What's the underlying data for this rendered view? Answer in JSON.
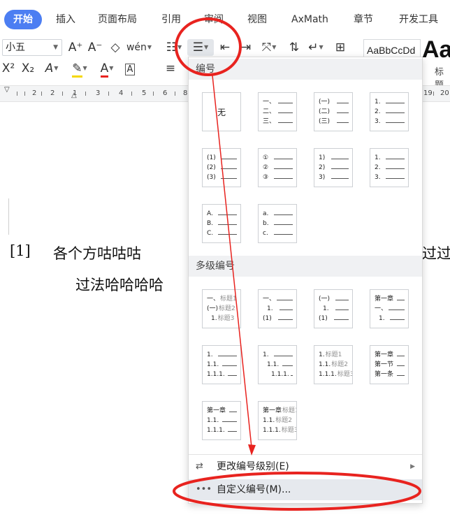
{
  "ribbon": {
    "tabs": [
      {
        "label": "开始",
        "active": true
      },
      {
        "label": "插入"
      },
      {
        "label": "页面布局"
      },
      {
        "label": "引用"
      },
      {
        "label": "审阅"
      },
      {
        "label": "视图"
      },
      {
        "label": "AxMath"
      },
      {
        "label": "章节"
      },
      {
        "label": "开发工具"
      }
    ]
  },
  "toolbar": {
    "font_size_value": "小五",
    "grow_font_label": "A⁺",
    "shrink_font_label": "A⁻",
    "pinyin_label": "wén",
    "superscript_label": "X²",
    "subscript_label": "X₂",
    "styles_preview_text": "AaBbCcDd",
    "styles_big_text": "Aa",
    "styles_caption": "标题"
  },
  "ruler": {
    "numbers": [
      "2",
      "1",
      "2",
      "3",
      "4",
      "5",
      "6",
      "7",
      "8",
      "19",
      "20"
    ]
  },
  "document": {
    "line1_ref": "[1]",
    "line1_text": "各个方咕咕咕",
    "line1_right": "过过",
    "line2_text": "过法哈哈哈哈"
  },
  "numbering_panel": {
    "numbering_header": "编号",
    "none_label": "无",
    "multilevel_header": "多级编号",
    "tiles_row1": [
      [
        "一、",
        "二、",
        "三、"
      ],
      [
        "(一)",
        "(二)",
        "(三)"
      ],
      [
        "1.",
        "2.",
        "3."
      ]
    ],
    "tiles_row2": [
      [
        "(1)",
        "(2)",
        "(3)"
      ],
      [
        "①",
        "②",
        "③"
      ],
      [
        "1)",
        "2)",
        "3)"
      ],
      [
        "1.",
        "2.",
        "3."
      ]
    ],
    "tiles_row3": [
      [
        "A.",
        "B.",
        "C."
      ],
      [
        "a.",
        "b.",
        "c."
      ]
    ],
    "multi_tiles": [
      {
        "rows": [
          {
            "lbl": "一、",
            "txt": "标题1"
          },
          {
            "lbl": "(一)",
            "txt": "标题2"
          },
          {
            "lbl": "1.",
            "txt": "标题3"
          }
        ]
      },
      {
        "rows": [
          {
            "lbl": "一、",
            "txt": ""
          },
          {
            "lbl": "1.",
            "txt": ""
          },
          {
            "lbl": "(1)",
            "txt": ""
          }
        ]
      },
      {
        "rows": [
          {
            "lbl": "(一)",
            "txt": ""
          },
          {
            "lbl": "1.",
            "txt": ""
          },
          {
            "lbl": "(1)",
            "txt": ""
          }
        ]
      },
      {
        "rows": [
          {
            "lbl": "第一章",
            "txt": ""
          },
          {
            "lbl": "一、",
            "txt": ""
          },
          {
            "lbl": "1.",
            "txt": ""
          }
        ]
      },
      {
        "rows": [
          {
            "lbl": "1.",
            "txt": ""
          },
          {
            "lbl": "1.1.",
            "txt": ""
          },
          {
            "lbl": "1.1.1.",
            "txt": ""
          }
        ]
      },
      {
        "rows": [
          {
            "lbl": "1.",
            "txt": ""
          },
          {
            "lbl": "1.1.",
            "txt": ""
          },
          {
            "lbl": "1.1.1.",
            "txt": ""
          }
        ]
      },
      {
        "rows": [
          {
            "lbl": "1.",
            "txt": "标题1"
          },
          {
            "lbl": "1.1.",
            "txt": "标题2"
          },
          {
            "lbl": "1.1.1.",
            "txt": "标题3"
          }
        ]
      },
      {
        "rows": [
          {
            "lbl": "第一章",
            "txt": ""
          },
          {
            "lbl": "第一节",
            "txt": ""
          },
          {
            "lbl": "第一条",
            "txt": ""
          }
        ]
      },
      {
        "rows": [
          {
            "lbl": "第一章",
            "txt": ""
          },
          {
            "lbl": "1.1.",
            "txt": ""
          },
          {
            "lbl": "1.1.1.",
            "txt": ""
          }
        ]
      },
      {
        "rows": [
          {
            "lbl": "第一章",
            "txt": "标题1"
          },
          {
            "lbl": "1.1.",
            "txt": "标题2"
          },
          {
            "lbl": "1.1.1.",
            "txt": "标题3"
          }
        ]
      }
    ],
    "change_level_label": "更改编号级别(E)",
    "custom_numbering_label": "自定义编号(M)...",
    "custom_icon": "•••",
    "change_level_icon": "⇄"
  },
  "colors": {
    "accent_blue": "#4c7ef2",
    "annotation_red": "#e8231f"
  }
}
